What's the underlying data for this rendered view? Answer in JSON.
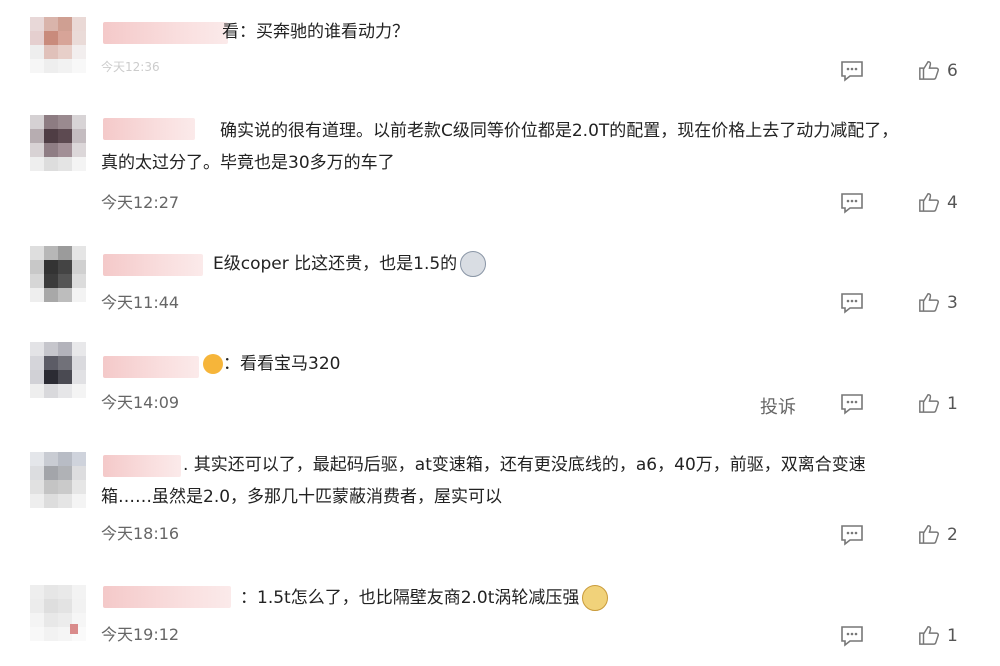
{
  "comments": [
    {
      "text": "看：买奔驰的谁看动力？",
      "time": "今天12:36",
      "likes": "6"
    },
    {
      "text_line1": "确实说的很有道理。以前老款C级同等价位都是2.0T的配置，现在价格上去了动力减配了，",
      "text_line2": "真的太过分了。毕竟也是30多万的车了",
      "time": "今天12:27",
      "likes": "4"
    },
    {
      "text": "E级coper 比这还贵，也是1.5的",
      "time": "今天11:44",
      "likes": "3"
    },
    {
      "text": "：看看宝马320",
      "time": "今天14:09",
      "likes": "1",
      "report": "投诉"
    },
    {
      "text_line1": ". 其实还可以了，最起码后驱，at变速箱，还有更没底线的，a6，40万，前驱，双离合变速",
      "text_line2": "箱……虽然是2.0，多那几十匹蒙蔽消费者，屋实可以",
      "time": "今天18:16",
      "likes": "2"
    },
    {
      "text": "：1.5t怎么了，也比隔壁友商2.0t涡轮减压强",
      "time": "今天19:12",
      "likes": "1"
    }
  ],
  "icons": {
    "comment": "comment-icon",
    "like": "thumbs-up-icon"
  },
  "colors": {
    "username_blur": "#f4c9c9",
    "text": "#222222",
    "meta": "#666666"
  }
}
